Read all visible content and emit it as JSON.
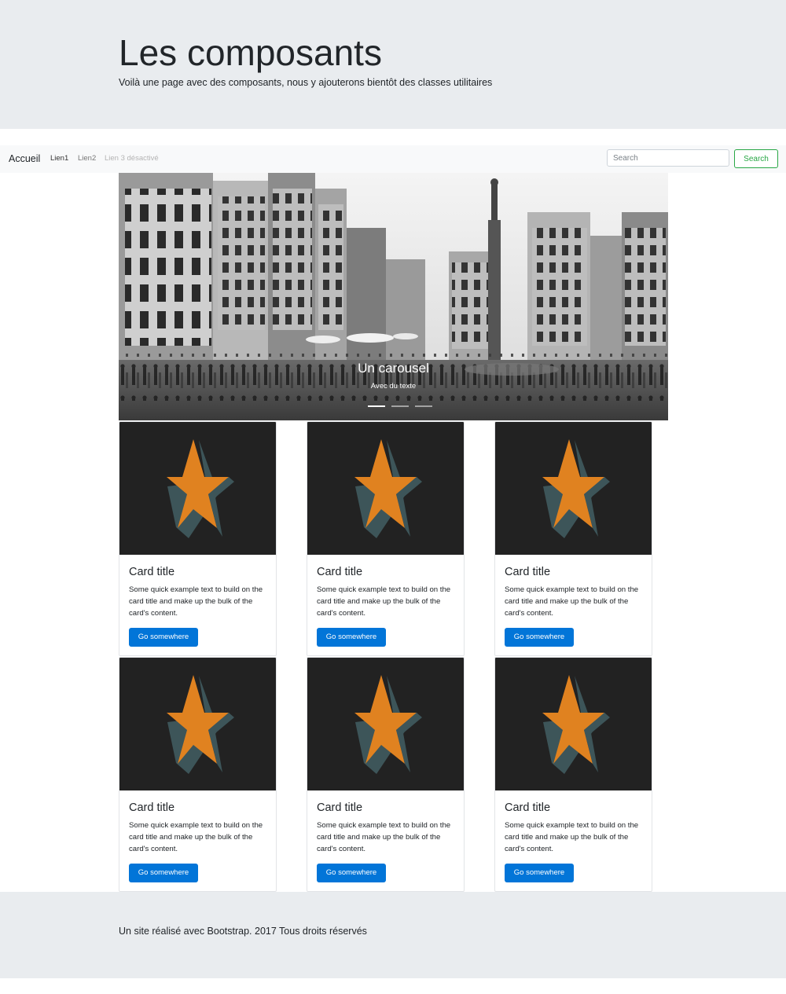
{
  "header": {
    "title": "Les composants",
    "lead": "Voilà une page avec des composants, nous y ajouterons bientôt des classes utilitaires"
  },
  "navbar": {
    "brand": "Accueil",
    "links": [
      {
        "label": "Lien1",
        "state": "active"
      },
      {
        "label": "Lien2",
        "state": "normal"
      },
      {
        "label": "Lien 3 désactivé",
        "state": "disabled"
      }
    ],
    "search_placeholder": "Search",
    "search_button": "Search"
  },
  "carousel": {
    "caption_title": "Un carousel",
    "caption_text": "Avec du texte",
    "slide_count": 3
  },
  "cards": [
    {
      "title": "Card title",
      "text": "Some quick example text to build on the card title and make up the bulk of the card's content.",
      "button": "Go somewhere",
      "image_icon": "star-icon"
    },
    {
      "title": "Card title",
      "text": "Some quick example text to build on the card title and make up the bulk of the card's content.",
      "button": "Go somewhere",
      "image_icon": "star-icon"
    },
    {
      "title": "Card title",
      "text": "Some quick example text to build on the card title and make up the bulk of the card's content.",
      "button": "Go somewhere",
      "image_icon": "star-icon"
    },
    {
      "title": "Card title",
      "text": "Some quick example text to build on the card title and make up the bulk of the card's content.",
      "button": "Go somewhere",
      "image_icon": "star-icon"
    },
    {
      "title": "Card title",
      "text": "Some quick example text to build on the card title and make up the bulk of the card's content.",
      "button": "Go somewhere",
      "image_icon": "star-icon"
    },
    {
      "title": "Card title",
      "text": "Some quick example text to build on the card title and make up the bulk of the card's content.",
      "button": "Go somewhere",
      "image_icon": "star-icon"
    }
  ],
  "footer": {
    "text": "Un site réalisé avec Bootstrap. 2017 Tous droits réservés"
  },
  "colors": {
    "jumbotron_bg": "#e9ecef",
    "navbar_bg": "#f8f9fa",
    "primary": "#0275d8",
    "success": "#28a745",
    "star": "#e08220",
    "star_shadow": "#3d5559",
    "card_image_bg": "#222222"
  }
}
